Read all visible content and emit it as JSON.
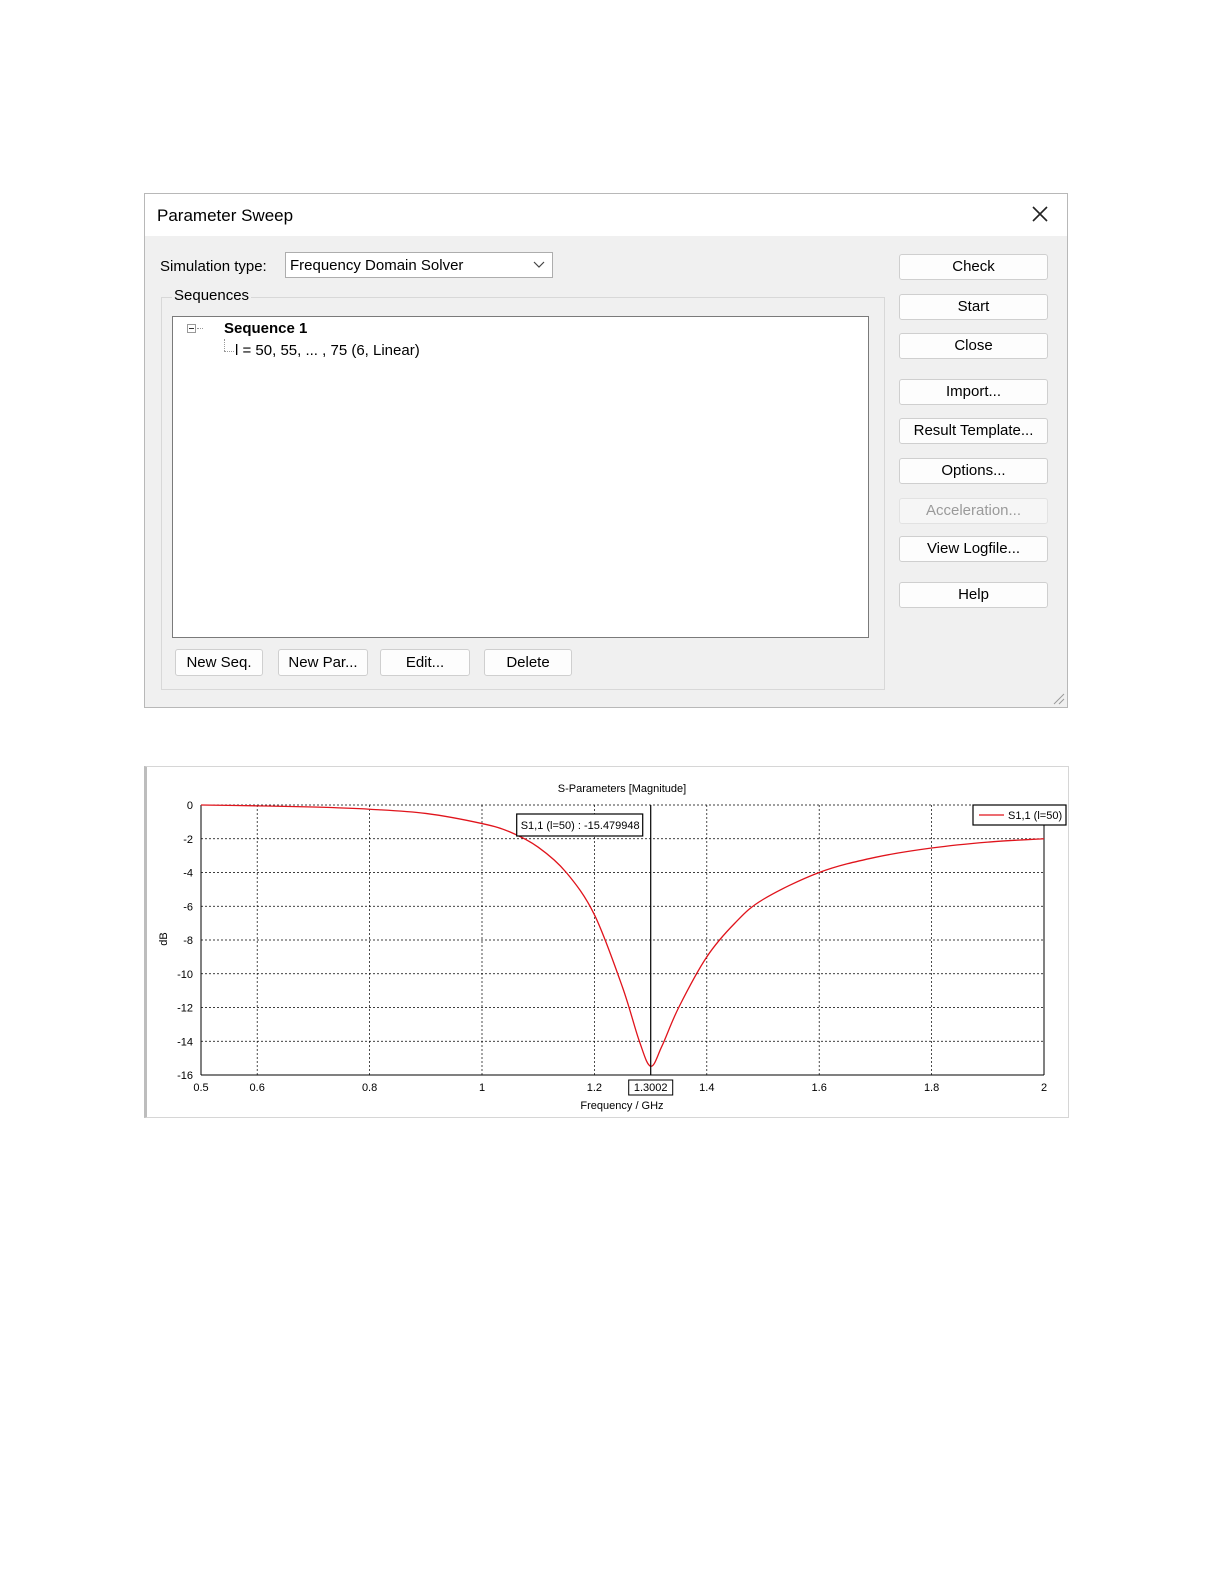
{
  "dialog": {
    "title": "Parameter Sweep",
    "close_icon": "close-icon",
    "simulation_type_label": "Simulation type:",
    "simulation_type_value": "Frequency Domain Solver",
    "sequences_label": "Sequences",
    "tree": {
      "sequence_name": "Sequence 1",
      "parameter_row": "l = 50, 55, ... , 75 (6, Linear)"
    },
    "side_buttons": {
      "check": "Check",
      "start": "Start",
      "close": "Close",
      "import": "Import...",
      "result_template": "Result Template...",
      "options": "Options...",
      "acceleration": "Acceleration...",
      "view_logfile": "View Logfile...",
      "help": "Help"
    },
    "bottom_buttons": {
      "new_seq": "New Seq.",
      "new_par": "New Par...",
      "edit": "Edit...",
      "delete": "Delete"
    }
  },
  "chart_data": {
    "type": "line",
    "title": "S-Parameters [Magnitude]",
    "xlabel": "Frequency / GHz",
    "ylabel": "dB",
    "xlim": [
      0.5,
      2
    ],
    "ylim": [
      -16,
      0
    ],
    "xticks": [
      "0.5",
      "0.6",
      "0.8",
      "1",
      "1.2",
      "1.4",
      "1.6",
      "1.8",
      "2"
    ],
    "yticks": [
      "0",
      "-2",
      "-4",
      "-6",
      "-8",
      "-10",
      "-12",
      "-14",
      "-16"
    ],
    "grid": true,
    "legend_position": "top-right",
    "line_color": "#e0141c",
    "series": [
      {
        "name": "S1,1 (l=50)",
        "x": [
          0.5,
          0.6,
          0.7,
          0.8,
          0.9,
          1.0,
          1.05,
          1.1,
          1.15,
          1.2,
          1.25,
          1.28,
          1.3002,
          1.32,
          1.35,
          1.4,
          1.45,
          1.5,
          1.6,
          1.7,
          1.8,
          1.9,
          2.0
        ],
        "y": [
          0,
          -0.05,
          -0.12,
          -0.25,
          -0.5,
          -1.1,
          -1.6,
          -2.5,
          -4.0,
          -6.5,
          -10.8,
          -14.0,
          -15.479948,
          -14.3,
          -12.0,
          -9.0,
          -7.0,
          -5.6,
          -4.0,
          -3.1,
          -2.55,
          -2.2,
          -2.0
        ]
      }
    ],
    "marker": {
      "x": 1.3002,
      "x_label": "1.3002",
      "label": "S1,1 (l=50) : -15.479948"
    }
  }
}
